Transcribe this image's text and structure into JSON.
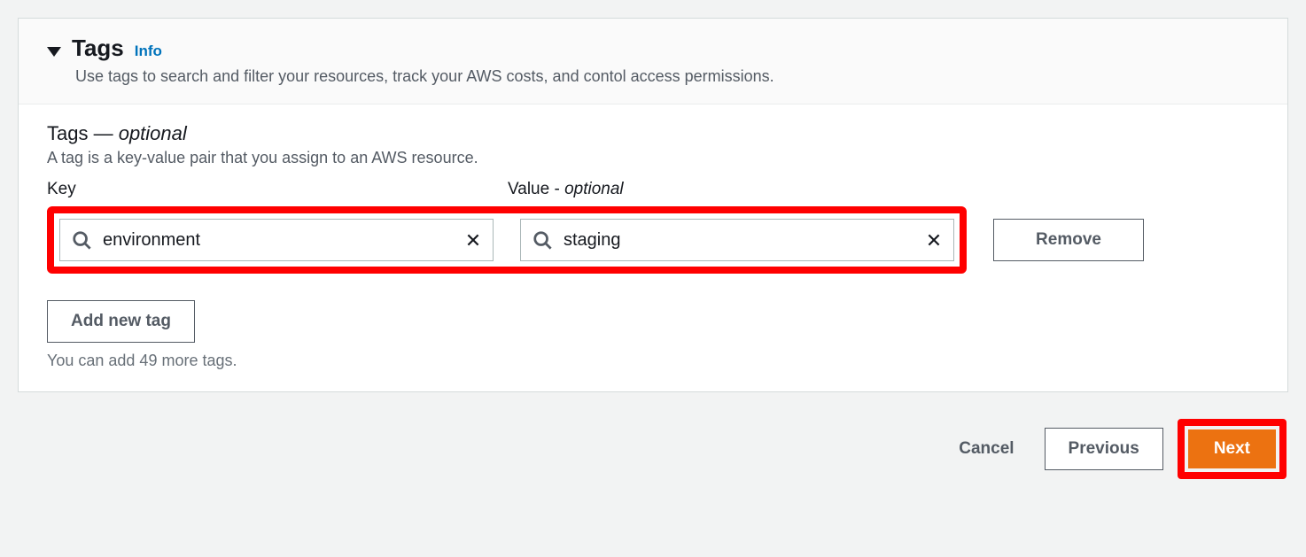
{
  "panel": {
    "title": "Tags",
    "info_link": "Info",
    "description": "Use tags to search and filter your resources, track your AWS costs, and contol access permissions."
  },
  "section": {
    "label_prefix": "Tags — ",
    "label_optional": "optional",
    "sub": "A tag is a key-value pair that you assign to an AWS resource."
  },
  "columns": {
    "key": "Key",
    "value_prefix": "Value - ",
    "value_optional": "optional"
  },
  "tag_row": {
    "key_value": "environment",
    "value_value": "staging",
    "remove_label": "Remove"
  },
  "add_button": "Add new tag",
  "hint": "You can add 49 more tags.",
  "footer": {
    "cancel": "Cancel",
    "previous": "Previous",
    "next": "Next"
  }
}
